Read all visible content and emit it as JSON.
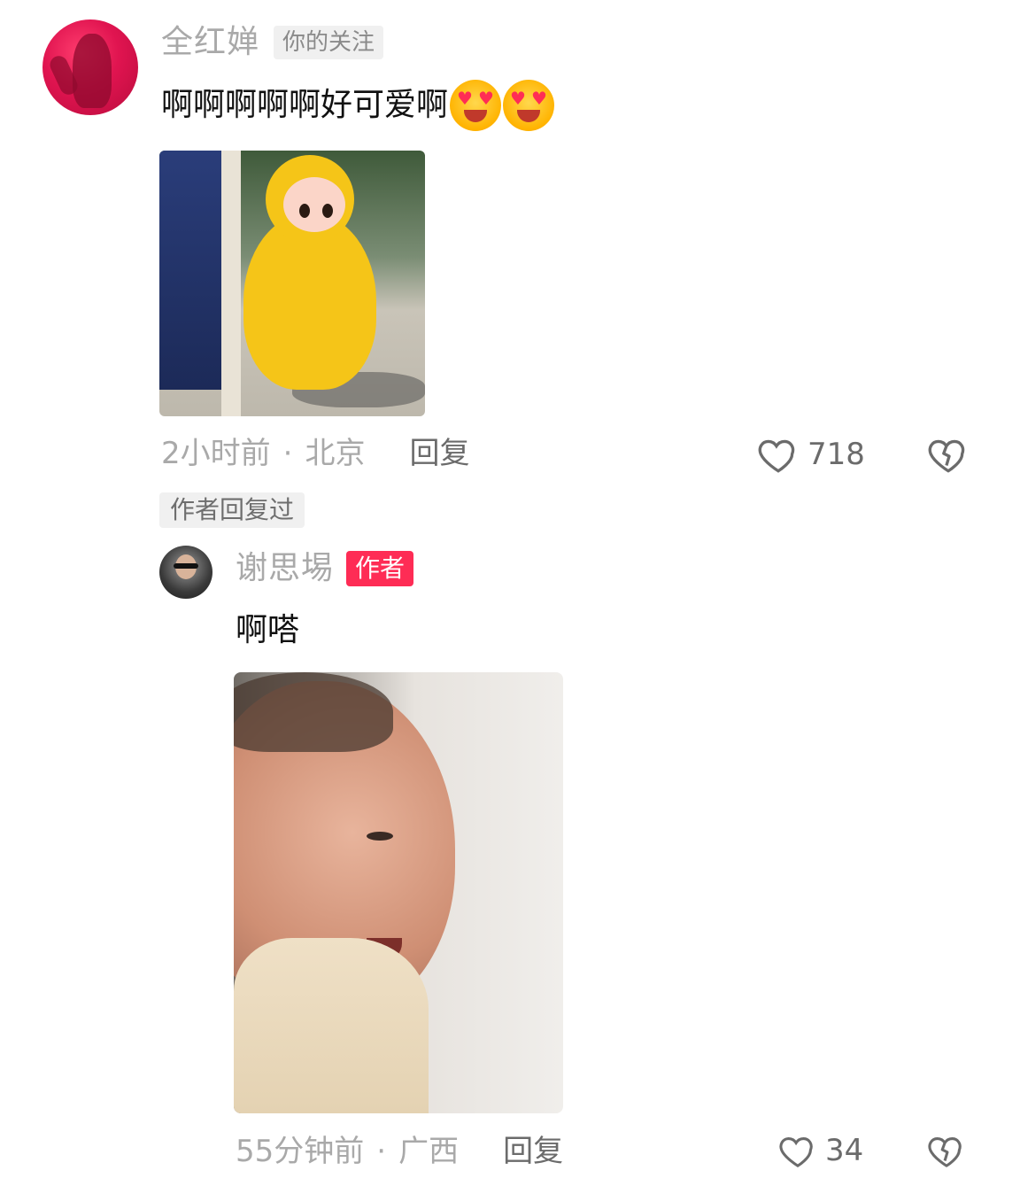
{
  "comment": {
    "username": "全红婵",
    "follow_tag": "你的关注",
    "text": "啊啊啊啊啊好可爱啊",
    "emojis": [
      "heart-eyes-tongue-emoji",
      "heart-eyes-tongue-emoji"
    ],
    "time": "2小时前",
    "separator": "·",
    "location": "北京",
    "reply_label": "回复",
    "likes": "718"
  },
  "author_replied_tag": "作者回复过",
  "reply": {
    "username": "谢思埸",
    "author_badge": "作者",
    "text": "啊嗒",
    "time": "55分钟前",
    "separator": "·",
    "location": "广西",
    "reply_label": "回复",
    "likes": "34"
  },
  "colors": {
    "accent": "#fe2c55",
    "meta_text": "#a9a9a9",
    "body_text": "#111111"
  }
}
